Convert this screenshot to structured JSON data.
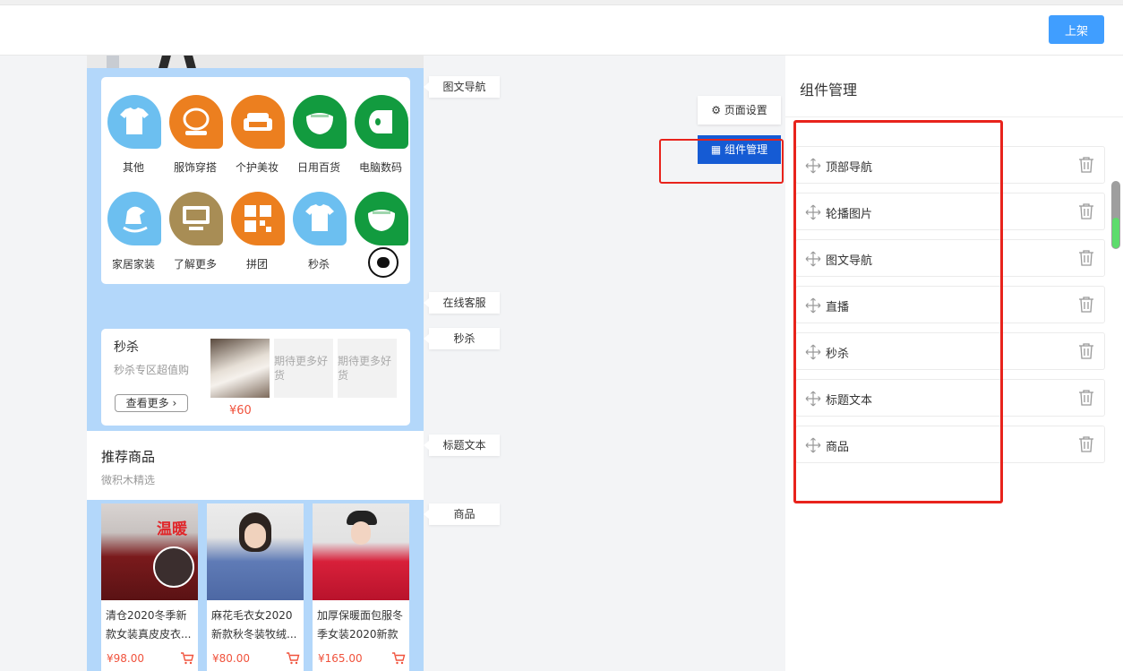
{
  "header": {
    "publish_label": "上架"
  },
  "preview": {
    "nav_items": [
      {
        "label": "其他",
        "icon": "tshirt-icon",
        "color": "#6cbff0"
      },
      {
        "label": "服饰穿搭",
        "icon": "mirror-icon",
        "color": "#ec7f1f"
      },
      {
        "label": "个护美妆",
        "icon": "sofa-icon",
        "color": "#ec7f1f"
      },
      {
        "label": "日用百货",
        "icon": "bowl-icon",
        "color": "#129b3f"
      },
      {
        "label": "电脑数码",
        "icon": "tissue-roll-icon",
        "color": "#129b3f"
      },
      {
        "label": "家居家装",
        "icon": "rocking-horse-icon",
        "color": "#6cbff0"
      },
      {
        "label": "了解更多",
        "icon": "monitor-icon",
        "color": "#a88d55"
      },
      {
        "label": "拼团",
        "icon": "grid-icon",
        "color": "#ec7f1f"
      },
      {
        "label": "秒杀",
        "icon": "tshirt-icon",
        "color": "#6cbff0"
      },
      {
        "label": "",
        "icon": "bowl-icon",
        "color": "#129b3f"
      }
    ],
    "seckill": {
      "title": "秒杀",
      "subtitle": "秒杀专区超值购",
      "more_label": "查看更多",
      "price": "¥60",
      "placeholder_1": "期待更多好货",
      "placeholder_2": "期待更多好货"
    },
    "title_text": {
      "title": "推荐商品",
      "subtitle": "微积木精选"
    },
    "products": [
      {
        "name": "清仓2020冬季新款女装真皮皮衣...",
        "price": "¥98.00",
        "badge": "温暖"
      },
      {
        "name": "麻花毛衣女2020新款秋冬装牧绒...",
        "price": "¥80.00"
      },
      {
        "name": "加厚保暖面包服冬季女装2020新款",
        "price": "¥165.00"
      }
    ]
  },
  "tags": {
    "image_nav": "图文导航",
    "online_service": "在线客服",
    "seckill": "秒杀",
    "title_text": "标题文本",
    "goods": "商品"
  },
  "side_buttons": {
    "page_settings": "页面设置",
    "component_manage": "组件管理"
  },
  "panel": {
    "title": "组件管理",
    "components": [
      "顶部导航",
      "轮播图片",
      "图文导航",
      "直播",
      "秒杀",
      "标题文本",
      "商品"
    ]
  },
  "colors": {
    "accent": "#155bd4",
    "publish": "#409eff",
    "highlight": "#e8231c",
    "price": "#f0523c",
    "preview_bg": "#b3d7fa"
  }
}
